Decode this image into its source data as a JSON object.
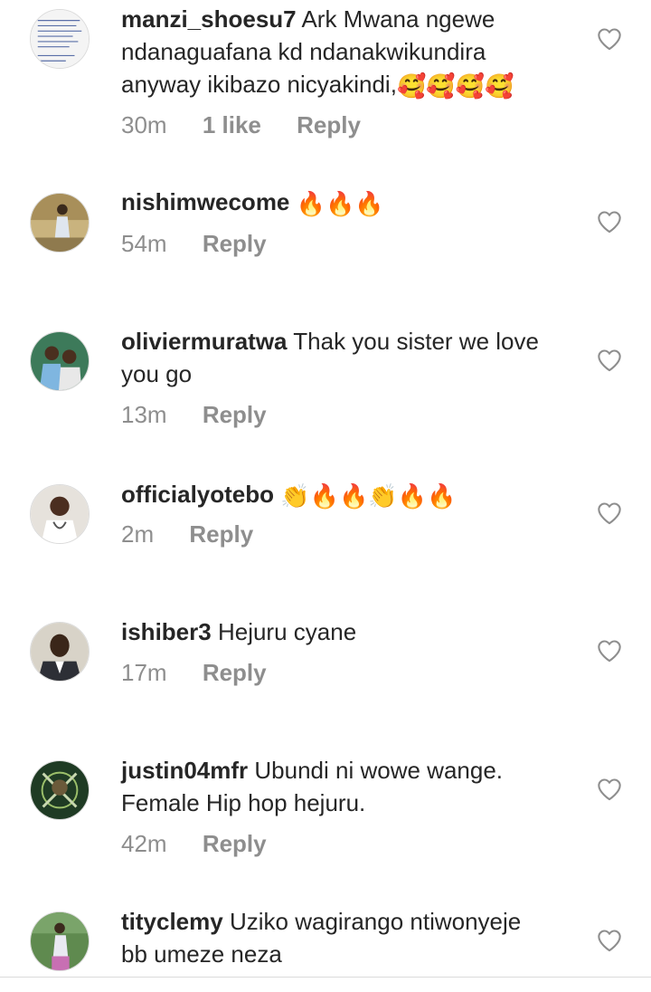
{
  "comments": [
    {
      "username": "manzi_shoesu7",
      "text": "Ark Mwana ngewe ndanaguafana kd ndanakwikundira anyway ikibazo nicyakindi,",
      "emoji": "🥰🥰🥰🥰",
      "time": "30m",
      "likes": "1 like",
      "reply": "Reply"
    },
    {
      "username": "nishimwecome",
      "text": "",
      "emoji": "🔥🔥🔥",
      "time": "54m",
      "reply": "Reply"
    },
    {
      "username": "oliviermuratwa",
      "text": "Thak you sister we love you go",
      "emoji": "",
      "time": "13m",
      "reply": "Reply"
    },
    {
      "username": "officialyotebo",
      "text": "",
      "emoji": "👏🔥🔥👏🔥🔥",
      "time": "2m",
      "reply": "Reply"
    },
    {
      "username": "ishiber3",
      "text": "Hejuru cyane",
      "emoji": "",
      "time": "17m",
      "reply": "Reply"
    },
    {
      "username": "justin04mfr",
      "text": "Ubundi ni wowe wange. Female Hip hop hejuru.",
      "emoji": "",
      "time": "42m",
      "reply": "Reply"
    },
    {
      "username": "tityclemy",
      "text": "Uziko wagirango ntiwonyeje bb umeze neza",
      "emoji": "",
      "time": "",
      "reply": ""
    }
  ],
  "icons": {
    "like": "heart-outline-icon"
  },
  "colors": {
    "text": "#262626",
    "meta": "#8e8e8e",
    "divider": "#dbdbdb"
  }
}
